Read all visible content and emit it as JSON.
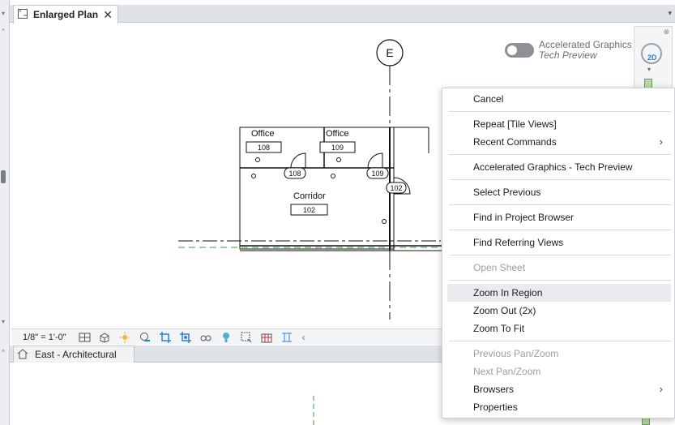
{
  "top_view": {
    "tab_label": "Enlarged Plan",
    "close_glyph": "✕",
    "dropdown_glyph": "▾"
  },
  "drawing": {
    "grid_bubble": "E",
    "rooms": [
      {
        "name": "Office",
        "number": "108"
      },
      {
        "name": "Office",
        "number": "109"
      },
      {
        "name": "Corridor",
        "number": "102"
      }
    ],
    "door_tags": [
      "108",
      "109",
      "102"
    ]
  },
  "accelerated_graphics": {
    "title": "Accelerated Graphics",
    "subtitle": "Tech Preview",
    "enabled": false
  },
  "navigation_bar": {
    "close_glyph": "⊗",
    "mode_label": "2D",
    "dropdown_glyph": "▾"
  },
  "view_control_bar": {
    "scale": "1/8\" = 1'-0\"",
    "icons": [
      "detail-level-icon",
      "visual-style-icon",
      "sun-path-icon",
      "shadows-icon",
      "crop-view-icon",
      "show-crop-region-icon",
      "temporary-hide-icon",
      "reveal-hidden-icon",
      "analytical-model-icon",
      "highlight-displacement-icon",
      "reveal-constraints-icon"
    ],
    "scroll_glyph": "‹"
  },
  "bottom_view": {
    "tab_label": "East - Architectural"
  },
  "context_menu": {
    "cancel": "Cancel",
    "repeat": "Repeat [Tile Views]",
    "recent_commands": "Recent Commands",
    "accelerated_graphics": "Accelerated Graphics - Tech Preview",
    "select_previous": "Select Previous",
    "find_in_project_browser": "Find in Project Browser",
    "find_referring_views": "Find Referring Views",
    "open_sheet": "Open Sheet",
    "zoom_in_region": "Zoom In Region",
    "zoom_out": "Zoom Out (2x)",
    "zoom_to_fit": "Zoom To Fit",
    "previous_pan_zoom": "Previous Pan/Zoom",
    "next_pan_zoom": "Next Pan/Zoom",
    "browsers": "Browsers",
    "properties": "Properties",
    "submenu_glyph": "›"
  },
  "colors": {
    "accent": "#2d7fd3",
    "section_line": "#3c9a3c"
  }
}
